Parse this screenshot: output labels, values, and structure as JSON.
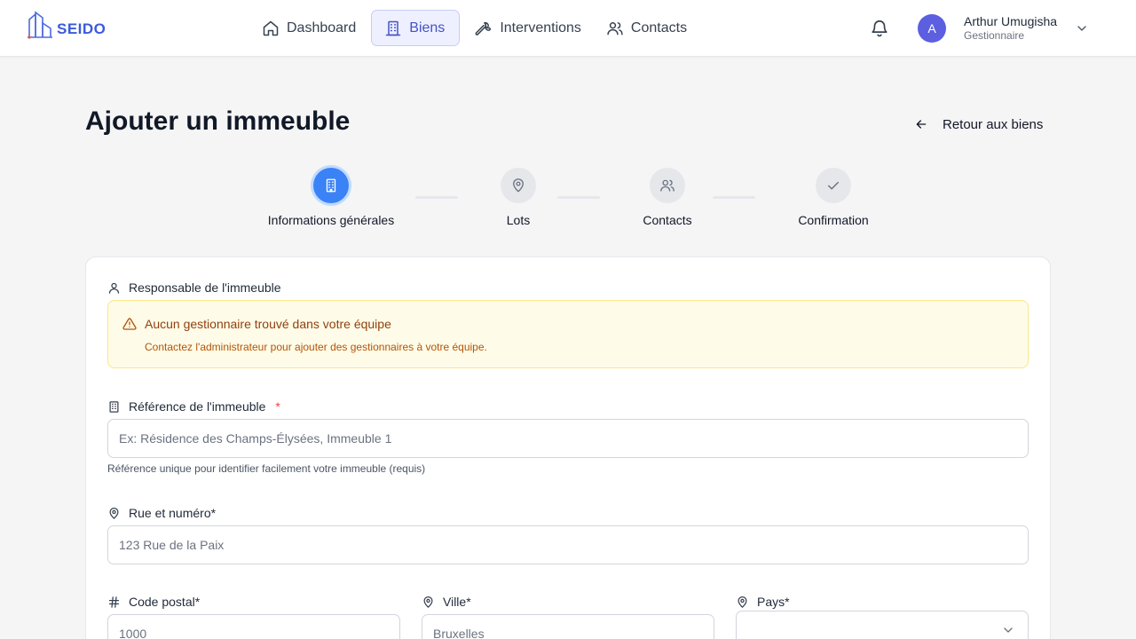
{
  "app": {
    "logo_text": "SEIDO"
  },
  "nav": {
    "items": [
      {
        "label": "Dashboard",
        "icon": "home-icon"
      },
      {
        "label": "Biens",
        "icon": "building-icon",
        "active": true
      },
      {
        "label": "Interventions",
        "icon": "wrench-icon"
      },
      {
        "label": "Contacts",
        "icon": "users-icon"
      }
    ]
  },
  "user": {
    "initial": "A",
    "name": "Arthur Umugisha",
    "role": "Gestionnaire"
  },
  "page": {
    "title": "Ajouter un immeuble",
    "back_label": "Retour aux biens"
  },
  "stepper": {
    "steps": [
      {
        "label": "Informations générales",
        "icon": "building-icon",
        "active": true
      },
      {
        "label": "Lots",
        "icon": "map-pin-icon"
      },
      {
        "label": "Contacts",
        "icon": "users-icon"
      },
      {
        "label": "Confirmation",
        "icon": "check-icon"
      }
    ]
  },
  "form": {
    "manager_label": "Responsable de l'immeuble",
    "alert_title": "Aucun gestionnaire trouvé dans votre équipe",
    "alert_text": "Contactez l'administrateur pour ajouter des gestionnaires à votre équipe.",
    "reference_label": "Référence de l'immeuble",
    "reference_required": "*",
    "reference_placeholder": "Ex: Résidence des Champs-Élysées, Immeuble 1",
    "reference_helper": "Référence unique pour identifier facilement votre immeuble (requis)",
    "street_label": "Rue et numéro*",
    "street_placeholder": "123 Rue de la Paix",
    "postal_label": "Code postal*",
    "postal_placeholder": "1000",
    "city_label": "Ville*",
    "city_placeholder": "Bruxelles",
    "country_label": "Pays*",
    "country_value": ""
  },
  "colors": {
    "accent": "#3b82f6",
    "brand": "#3b5bdb",
    "alert_bg": "#fefce8",
    "alert_text": "#92400e"
  }
}
